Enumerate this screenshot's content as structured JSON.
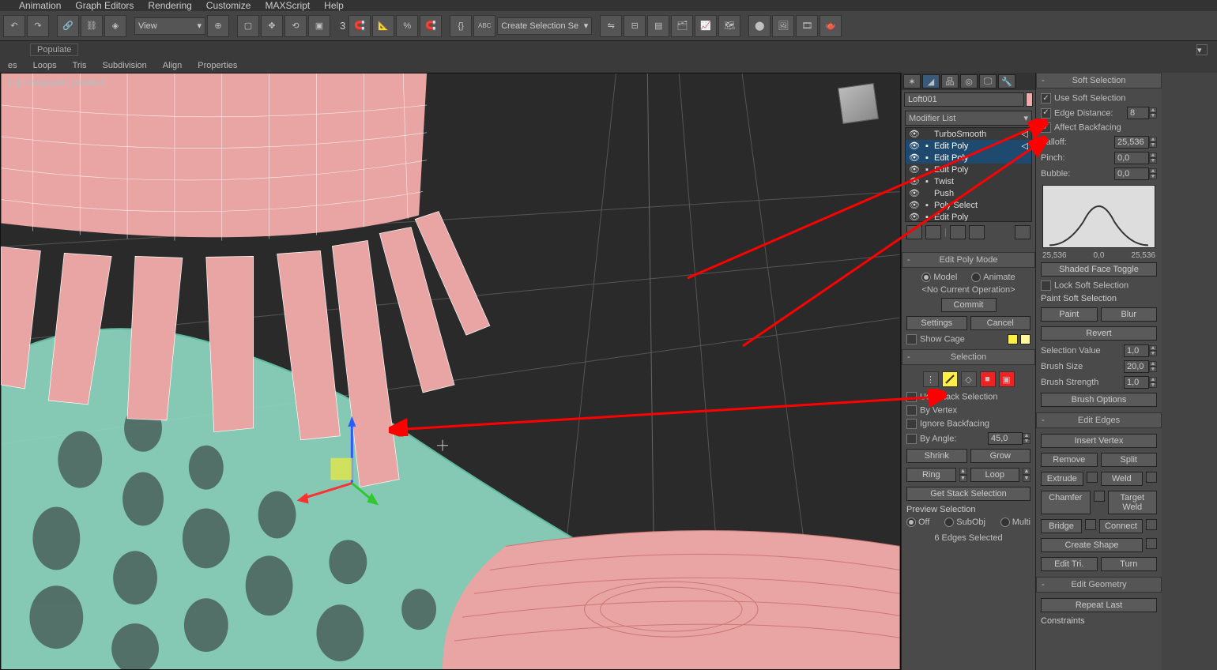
{
  "menu": {
    "items": [
      "Animation",
      "Graph Editors",
      "Rendering",
      "Customize",
      "MAXScript",
      "Help"
    ]
  },
  "toolbar": {
    "view_dropdown": "View",
    "angle_value": "3",
    "create_selection": "Create Selection Se"
  },
  "populate_label": "Populate",
  "sec_menu": [
    "es",
    "Loops",
    "Tris",
    "Subdivision",
    "Align",
    "Properties"
  ],
  "viewport_label": "[+][orthographic][shaded]",
  "panel": {
    "object_name": "Loft001",
    "modifier_list_label": "Modifier List",
    "stack": [
      {
        "name": "TurboSmooth",
        "active": false
      },
      {
        "name": "Edit Poly",
        "active": true
      },
      {
        "name": "Edit Poly",
        "active": true
      },
      {
        "name": "Edit Poly",
        "active": false
      },
      {
        "name": "Twist",
        "active": false
      },
      {
        "name": "Push",
        "active": false
      },
      {
        "name": "Poly Select",
        "active": false
      },
      {
        "name": "Edit Poly",
        "active": false
      }
    ],
    "epm": {
      "title": "Edit Poly Mode",
      "model": "Model",
      "animate": "Animate",
      "no_op": "<No Current Operation>",
      "commit": "Commit",
      "settings": "Settings",
      "cancel": "Cancel",
      "show_cage": "Show Cage"
    },
    "selection": {
      "title": "Selection",
      "use_stack": "Use Stack Selection",
      "by_vertex": "By Vertex",
      "ignore_bf": "Ignore Backfacing",
      "by_angle": "By Angle:",
      "by_angle_val": "45,0",
      "shrink": "Shrink",
      "grow": "Grow",
      "ring": "Ring",
      "loop": "Loop",
      "get_stack": "Get Stack Selection",
      "preview": "Preview Selection",
      "off": "Off",
      "subobj": "SubObj",
      "multi": "Multi",
      "status": "6 Edges Selected"
    }
  },
  "soft": {
    "title": "Soft Selection",
    "use_ss": "Use Soft Selection",
    "edge_dist": "Edge Distance:",
    "edge_dist_val": "8",
    "affect_bf": "Affect Backfacing",
    "falloff": "Falloff:",
    "falloff_val": "25,536",
    "pinch": "Pinch:",
    "pinch_val": "0,0",
    "bubble": "Bubble:",
    "bubble_val": "0,0",
    "axis_l": "25,536",
    "axis_c": "0,0",
    "axis_r": "25,536",
    "shaded": "Shaded Face Toggle",
    "lock": "Lock Soft Selection",
    "paint_hdr": "Paint Soft Selection",
    "paint": "Paint",
    "blur": "Blur",
    "revert": "Revert",
    "sel_val": "Selection Value",
    "sel_val_v": "1,0",
    "brush_size": "Brush Size",
    "brush_size_v": "20,0",
    "brush_str": "Brush Strength",
    "brush_str_v": "1,0",
    "brush_opt": "Brush Options"
  },
  "edges": {
    "title": "Edit Edges",
    "insert": "Insert Vertex",
    "remove": "Remove",
    "split": "Split",
    "extrude": "Extrude",
    "weld": "Weld",
    "chamfer": "Chamfer",
    "target": "Target Weld",
    "bridge": "Bridge",
    "connect": "Connect",
    "create": "Create Shape",
    "edit_tri": "Edit Tri.",
    "turn": "Turn"
  },
  "geom": {
    "title": "Edit Geometry",
    "repeat": "Repeat Last",
    "constraints": "Constraints"
  }
}
